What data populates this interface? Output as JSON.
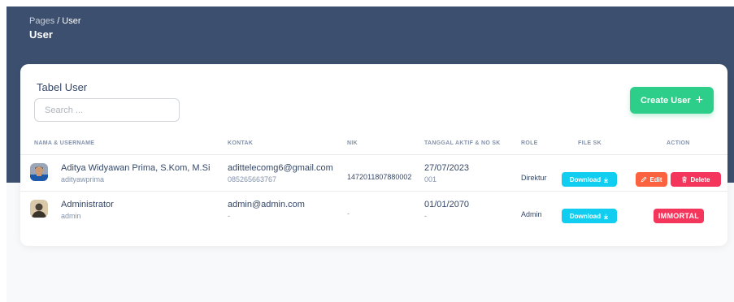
{
  "breadcrumb": {
    "root": "Pages",
    "separator": "/",
    "current": "User"
  },
  "page_title": "User",
  "card": {
    "title": "Tabel User",
    "search_placeholder": "Search ...",
    "create_button_label": "Create User",
    "create_button_icon": "+"
  },
  "table": {
    "headers": {
      "name": "NAMA & USERNAME",
      "contact": "KONTAK",
      "nik": "NIK",
      "date": "TANGGAL AKTIF & NO SK",
      "role": "ROLE",
      "file": "FILE SK",
      "action": "ACTION"
    },
    "rows": [
      {
        "name": "Aditya Widyawan Prima, S.Kom, M.Si",
        "username": "adityawprima",
        "email": "adittelecomg6@gmail.com",
        "phone": "085265663767",
        "nik": "1472011807880002",
        "date": "27/07/2023",
        "sk_no": "001",
        "role": "Direktur",
        "download_label": "Download",
        "edit_label": "Edit",
        "delete_label": "Delete"
      },
      {
        "name": "Administrator",
        "username": "admin",
        "email": "admin@admin.com",
        "phone": "-",
        "nik": "-",
        "date": "01/01/2070",
        "sk_no": "-",
        "role": "Admin",
        "download_label": "Download",
        "immortal_label": "IMMORTAL"
      }
    ]
  },
  "colors": {
    "header_bg": "#3c4f6e",
    "success": "#2dce89",
    "info": "#11cdef",
    "warning": "#fb6340",
    "danger": "#f5365c",
    "text_dark": "#344767",
    "text_muted": "#8392ab"
  },
  "icons": {
    "download": "download-icon",
    "edit": "pencil-icon",
    "delete": "trash-icon",
    "create": "plus-icon"
  }
}
